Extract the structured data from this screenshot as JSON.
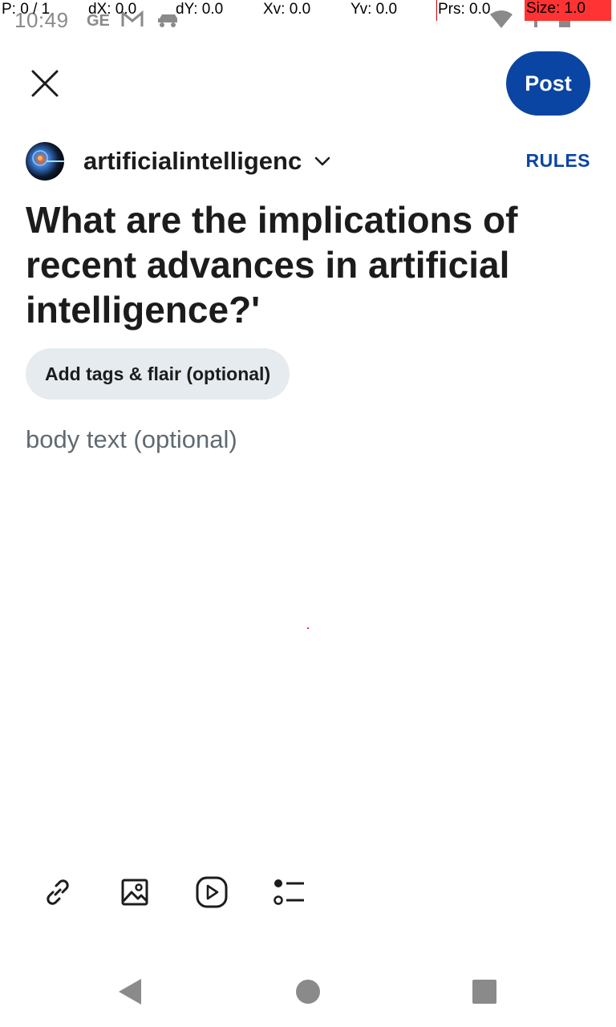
{
  "status_bar": {
    "time": "10:49",
    "left_icons": [
      "carrier-icon",
      "gmail-icon",
      "car-icon"
    ],
    "right_icons": [
      "wifi-icon",
      "signal-icon",
      "battery-icon"
    ]
  },
  "debug_overlay": {
    "pointer": "P: 0 / 1",
    "dx": "dX: 0.0",
    "dy": "dY: 0.0",
    "xv": "Xv: 0.0",
    "yv": "Yv: 0.0",
    "prs": "Prs: 0.0",
    "size": "Size: 1.0"
  },
  "header": {
    "close_icon": "close-icon",
    "post_label": "Post"
  },
  "community": {
    "name": "artificialintelligenc",
    "rules_label": "RULES"
  },
  "post": {
    "title": "What are the implications of recent advances in artificial intelligence?'",
    "tags_label": "Add tags & flair (optional)",
    "body_placeholder": "body text (optional)",
    "body_value": ""
  },
  "toolbar": {
    "items": [
      "link-icon",
      "image-icon",
      "video-icon",
      "poll-icon"
    ]
  },
  "nav": {
    "items": [
      "back-icon",
      "home-icon",
      "recents-icon"
    ]
  },
  "colors": {
    "accent": "#0b45a3",
    "chip_bg": "#e5ebee",
    "placeholder": "#5f6b73",
    "text": "#1c1c1c"
  }
}
